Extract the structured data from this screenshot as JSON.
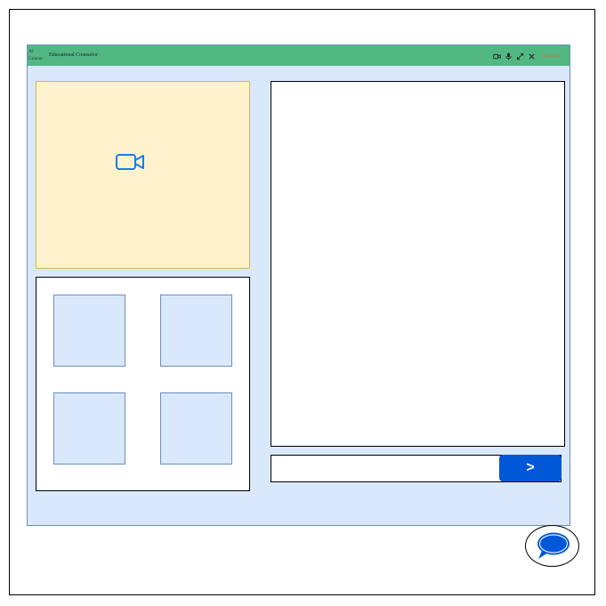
{
  "window": {
    "logo_text": "AI Course",
    "title": "Educational Counselor"
  },
  "title_controls": {
    "camera_icon": "video-camera-icon",
    "mic_icon": "microphone-icon",
    "fullscreen_icon": "expand-icon",
    "close_icon": "close-icon",
    "end_label": "End Class"
  },
  "main_video": {
    "icon": "video-camera-icon"
  },
  "participants": {
    "count": 4
  },
  "chat": {
    "input_value": "",
    "send_label": ">"
  },
  "floating": {
    "icon": "chat-bubble-icon"
  },
  "colors": {
    "title_bar": "#52b883",
    "window_bg": "#dae8fc",
    "video_bg": "#fff2cc",
    "accent_blue": "#0057d8",
    "end_label": "#e26a2c"
  }
}
